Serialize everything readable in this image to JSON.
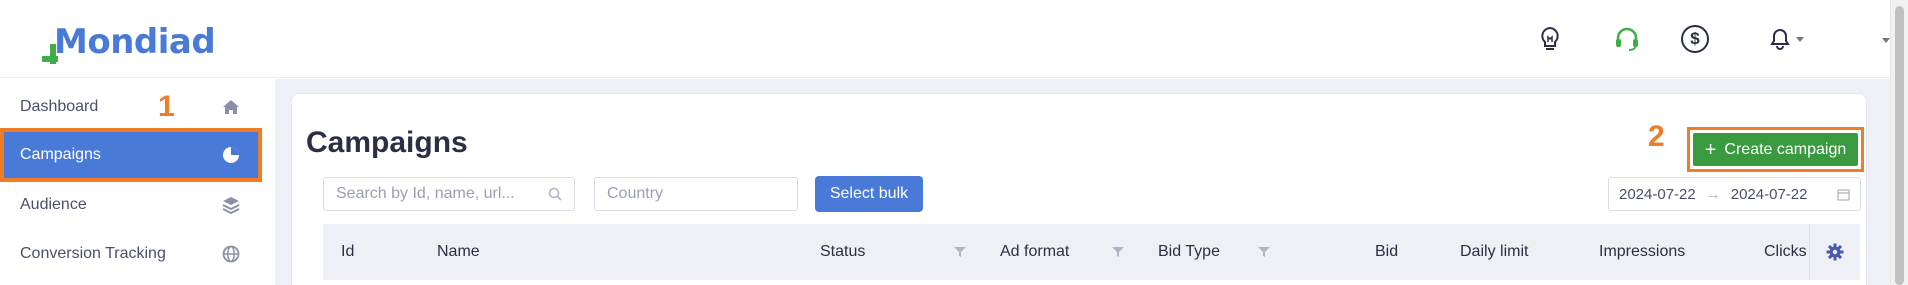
{
  "brand": {
    "logo_text": "Mondiad"
  },
  "header": {
    "icons": [
      "lightbulb-icon",
      "headset-icon",
      "dollar-icon",
      "bell-icon"
    ]
  },
  "sidebar": {
    "items": [
      {
        "label": "Dashboard",
        "icon": "home-icon"
      },
      {
        "label": "Campaigns",
        "icon": "pie-chart-icon",
        "active": true
      },
      {
        "label": "Audience",
        "icon": "layers-icon"
      },
      {
        "label": "Conversion Tracking",
        "icon": "globe-icon"
      }
    ]
  },
  "annotations": {
    "step1": "1",
    "step2": "2"
  },
  "page": {
    "title": "Campaigns",
    "search_placeholder": "Search by Id, name, url...",
    "country_placeholder": "Country",
    "select_bulk_label": "Select bulk",
    "create_campaign_label": "Create campaign",
    "date_from": "2024-07-22",
    "date_to": "2024-07-22"
  },
  "table": {
    "columns": [
      "Id",
      "Name",
      "Status",
      "Ad format",
      "Bid Type",
      "Bid",
      "Daily limit",
      "Impressions",
      "Clicks"
    ]
  },
  "colors": {
    "brand_blue": "#4a7ad8",
    "brand_green": "#3fae49",
    "create_button": "#3a9a3f",
    "annotation_orange": "#f07c26"
  }
}
